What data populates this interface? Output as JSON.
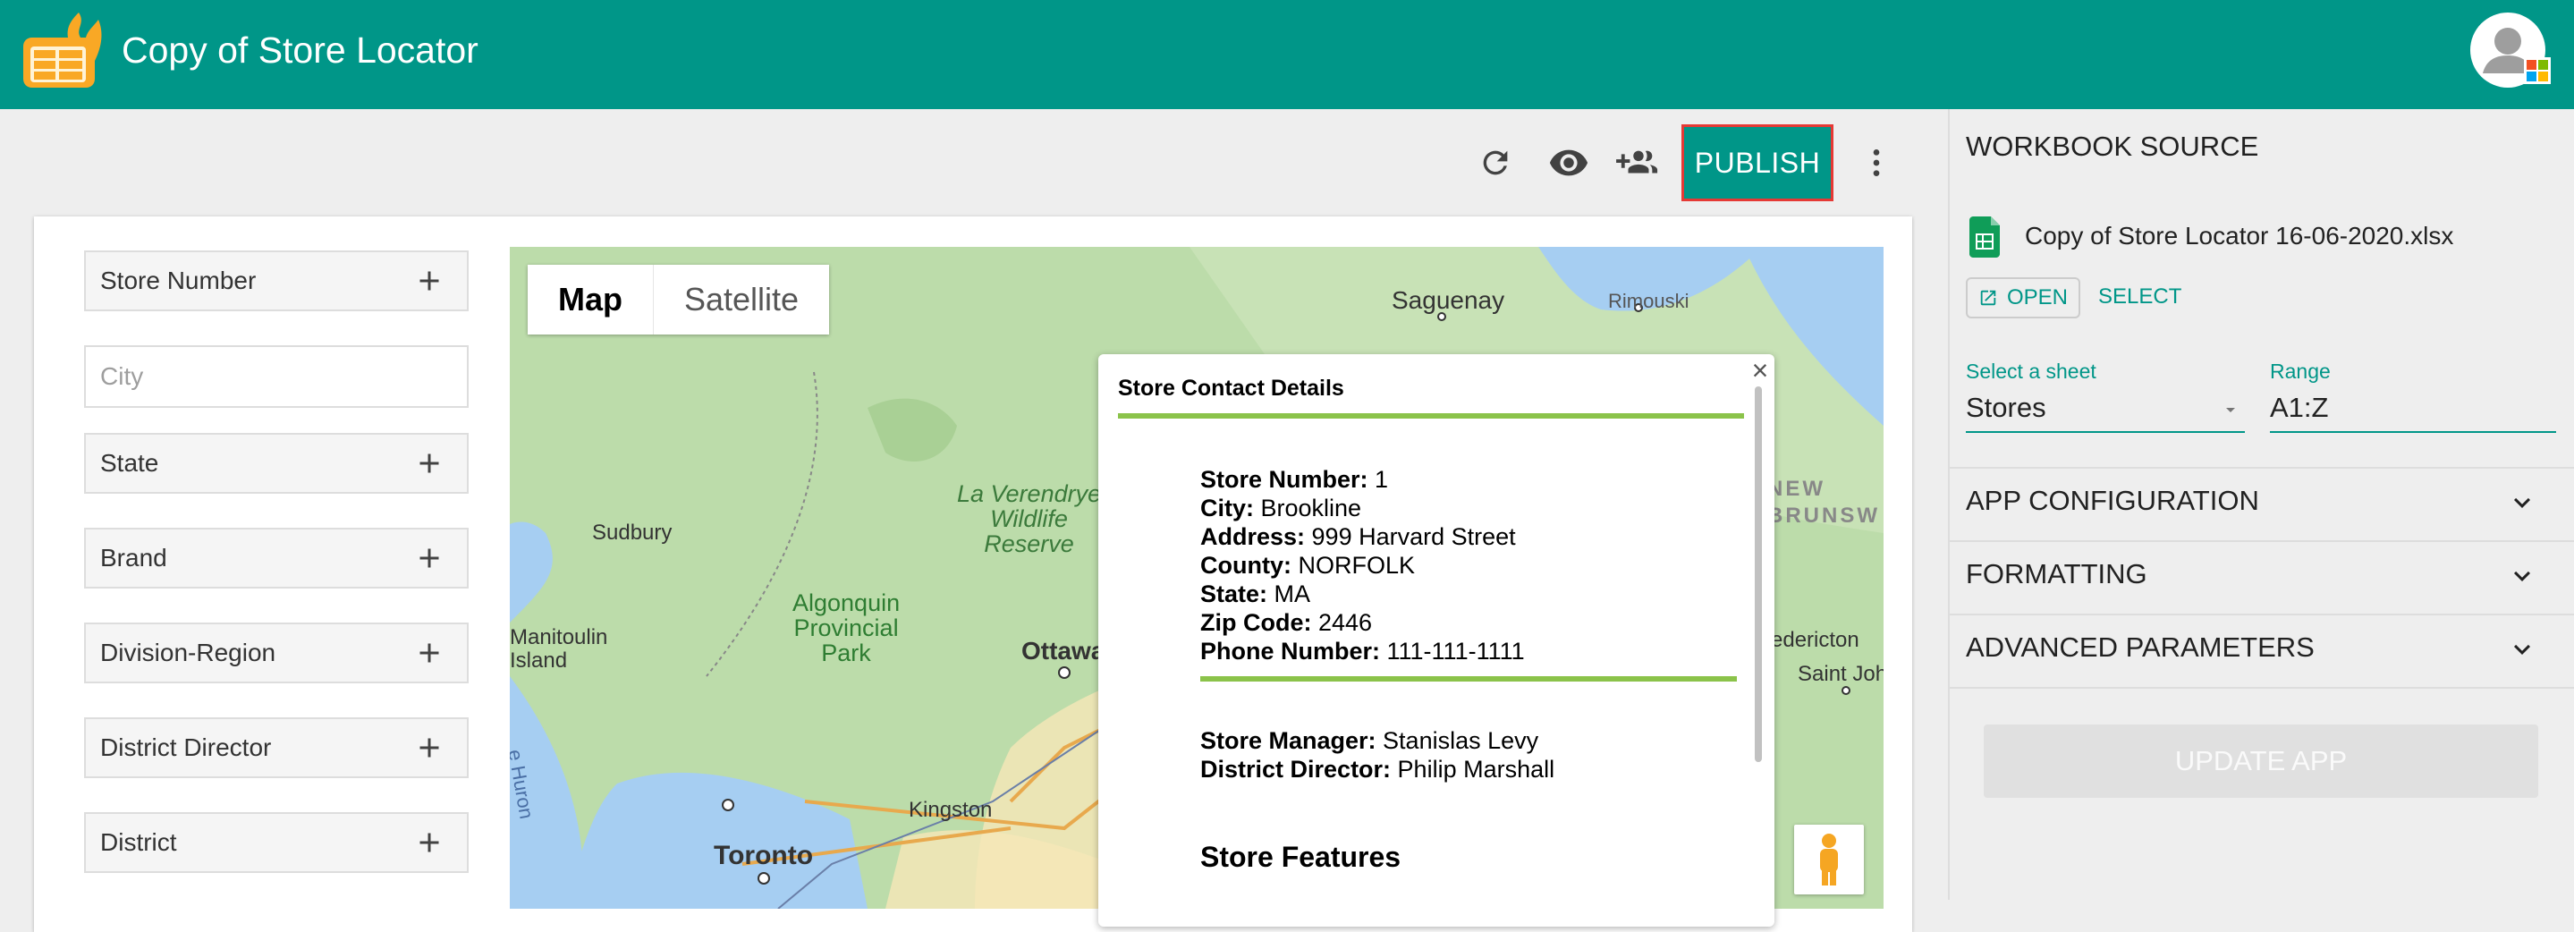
{
  "app": {
    "title": "Copy of Store Locator"
  },
  "toolbar": {
    "publish_label": "PUBLISH",
    "icons": [
      "refresh-icon",
      "eye-icon",
      "group-add-icon",
      "more-vert-icon"
    ]
  },
  "filters": {
    "store_number": "Store Number",
    "city_placeholder": "City",
    "state": "State",
    "brand": "Brand",
    "division_region": "Division-Region",
    "district_director": "District Director",
    "district": "District"
  },
  "map": {
    "type_map": "Map",
    "type_satellite": "Satellite",
    "labels": {
      "saguenay": "Saguenay",
      "rimouski": "Rimouski",
      "la_verendrye": "La Verendrye\nWildlife\nReserve",
      "sudbury": "Sudbury",
      "algonquin": "Algonquin\nProvincial\nPark",
      "manitoulin": "Manitoulin\nIsland",
      "ottawa": "Ottawa",
      "kingston": "Kingston",
      "toronto": "Toronto",
      "new_brunswick": "NEW\nBRUNSW",
      "fredericton": "edericton",
      "saint_john": "Saint Joh",
      "huron": "e Huron"
    }
  },
  "popup": {
    "title": "Store Contact Details",
    "fields": [
      {
        "label": "Store Number:",
        "value": " 1"
      },
      {
        "label": "City:",
        "value": " Brookline"
      },
      {
        "label": "Address:",
        "value": " 999 Harvard Street"
      },
      {
        "label": "County:",
        "value": " NORFOLK"
      },
      {
        "label": "State:",
        "value": " MA"
      },
      {
        "label": "Zip Code:",
        "value": " 2446"
      },
      {
        "label": "Phone Number:",
        "value": " 111-111-1111"
      }
    ],
    "manager_fields": [
      {
        "label": "Store Manager:",
        "value": " Stanislas Levy"
      },
      {
        "label": "District Director:",
        "value": " Philip Marshall"
      }
    ],
    "features_title": "Store Features",
    "close": "×"
  },
  "panel": {
    "workbook_source": "WORKBOOK SOURCE",
    "file_name": "Copy of Store Locator 16-06-2020.xlsx",
    "open_label": "OPEN",
    "select_label": "SELECT",
    "sheet_label": "Select a sheet",
    "sheet_value": "Stores",
    "range_label": "Range",
    "range_value": "A1:Z",
    "app_configuration": "APP CONFIGURATION",
    "formatting": "FORMATTING",
    "advanced_parameters": "ADVANCED PARAMETERS",
    "update_label": "UPDATE APP"
  },
  "colors": {
    "primary": "#009688",
    "accent_rule": "#8bc34a",
    "publish_border": "#e53935",
    "logo_orange": "#f9a825"
  }
}
